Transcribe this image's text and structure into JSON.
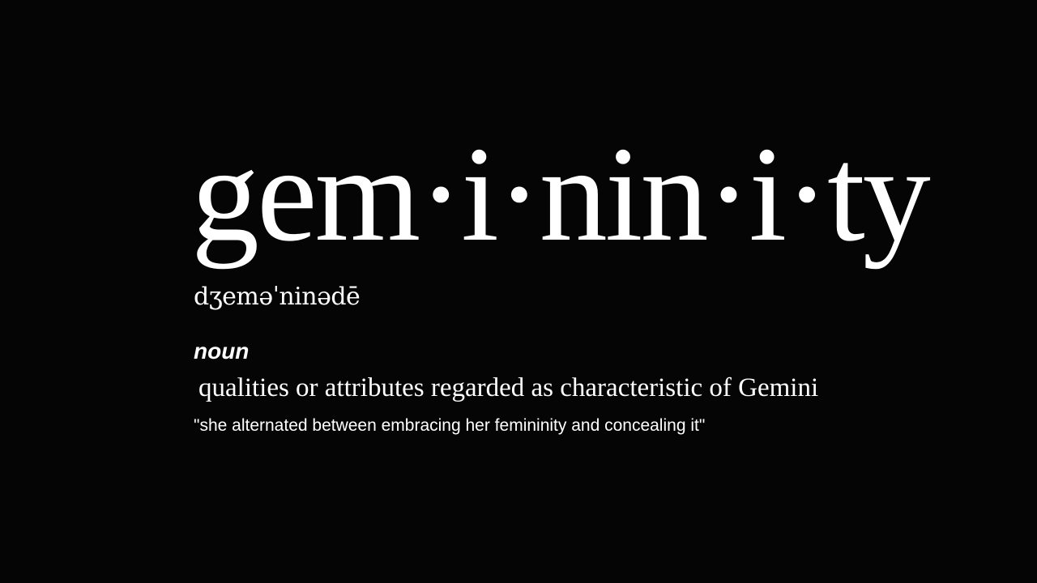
{
  "entry": {
    "headword": "gem·i·nin·i·ty",
    "pronunciation": "dʒeməˈninədē",
    "part_of_speech": "noun",
    "definition": "qualities or attributes regarded as characteristic of Gemini",
    "example": "\"she alternated between embracing her femininity and concealing it\""
  },
  "colors": {
    "background": "#050505",
    "text": "#ffffff"
  }
}
